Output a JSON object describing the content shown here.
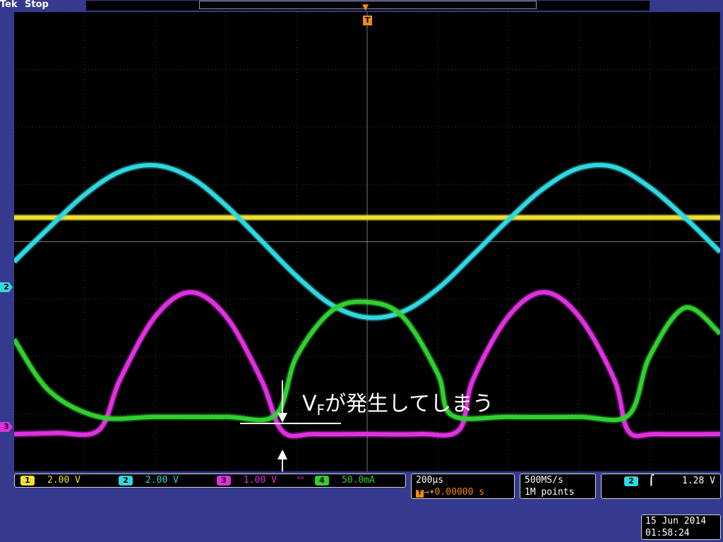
{
  "header": {
    "brand": "Tek",
    "acq_state": "Stop"
  },
  "trigger_marker": "T",
  "channel_markers": {
    "ch2": "2",
    "ch3": "3"
  },
  "channels": [
    {
      "id": "1",
      "scale": "2.00 V",
      "color": "#f0e030"
    },
    {
      "id": "2",
      "scale": "2.00 V",
      "color": "#30d8e0"
    },
    {
      "id": "3",
      "scale": "1.00 V",
      "color": "#e030e0",
      "bw_icon": "bandwidth-limit-icon"
    },
    {
      "id": "4",
      "scale": "50.0mA",
      "color": "#30d030"
    }
  ],
  "timebase": {
    "scale": "200µs",
    "trigger_offset": "0.00000 s"
  },
  "acquisition": {
    "sample_rate": "500MS/s",
    "record_length": "1M points"
  },
  "trigger": {
    "source": "2",
    "slope_icon": "rising-edge-icon",
    "slope": "⌠",
    "level": "1.28 V"
  },
  "datetime": {
    "date": "15 Jun 2014",
    "time": "01:58:24"
  },
  "annotation": {
    "v": "V",
    "sub": "F",
    "rest": "が発生してしまう"
  },
  "chart_data": {
    "type": "line",
    "x_unit": "s",
    "xlim": [
      -0.001,
      0.001
    ],
    "y_unit": "div",
    "ylim": [
      -4,
      4
    ],
    "grid": true,
    "series": [
      {
        "channel": "1",
        "color": "#f0e030",
        "x": [
          -0.001,
          0.001
        ],
        "y": [
          0.42,
          0.42
        ]
      },
      {
        "channel": "2",
        "color": "#30d8e0",
        "x": [
          -0.001,
          -0.0009,
          -0.0008,
          -0.0007,
          -0.0006,
          -0.0005,
          -0.0004,
          -0.0003,
          -0.0002,
          -0.0001,
          0,
          0.0001,
          0.0002,
          0.0003,
          0.0004,
          0.0005,
          0.0006,
          0.0007,
          0.0008,
          0.0009,
          0.001
        ],
        "y": [
          -0.35,
          0.25,
          0.82,
          1.22,
          1.33,
          1.12,
          0.63,
          0.02,
          -0.6,
          -1.1,
          -1.32,
          -1.22,
          -0.82,
          -0.23,
          0.38,
          0.93,
          1.28,
          1.3,
          0.95,
          0.42,
          -0.18
        ]
      },
      {
        "channel": "3",
        "color": "#e030e0",
        "x": [
          -0.001,
          -0.00088,
          -0.00076,
          -0.0007,
          -0.0006,
          -0.0005,
          -0.0004,
          -0.0003,
          -0.00024,
          -0.00015,
          0,
          0.00015,
          0.00026,
          0.0003,
          0.0004,
          0.0005,
          0.0006,
          0.0007,
          0.00074,
          0.00082,
          0.001
        ],
        "y": [
          -3.35,
          -3.33,
          -3.28,
          -2.4,
          -1.3,
          -0.88,
          -1.3,
          -2.4,
          -3.3,
          -3.35,
          -3.35,
          -3.35,
          -3.28,
          -2.4,
          -1.3,
          -0.88,
          -1.3,
          -2.4,
          -3.3,
          -3.35,
          -3.35
        ]
      },
      {
        "channel": "4",
        "color": "#30d030",
        "x": [
          -0.001,
          -0.0009,
          -0.00076,
          -0.0006,
          -0.0004,
          -0.00026,
          -0.0002,
          -0.0001,
          0,
          0.0001,
          0.0002,
          0.00024,
          0.0004,
          0.0006,
          0.00074,
          0.0008,
          0.0009,
          0.001
        ],
        "y": [
          -1.7,
          -2.6,
          -3.05,
          -3.05,
          -3.05,
          -3.02,
          -2.0,
          -1.2,
          -1.05,
          -1.3,
          -2.3,
          -3.02,
          -3.05,
          -3.05,
          -3.02,
          -2.0,
          -1.15,
          -1.6
        ]
      }
    ]
  }
}
